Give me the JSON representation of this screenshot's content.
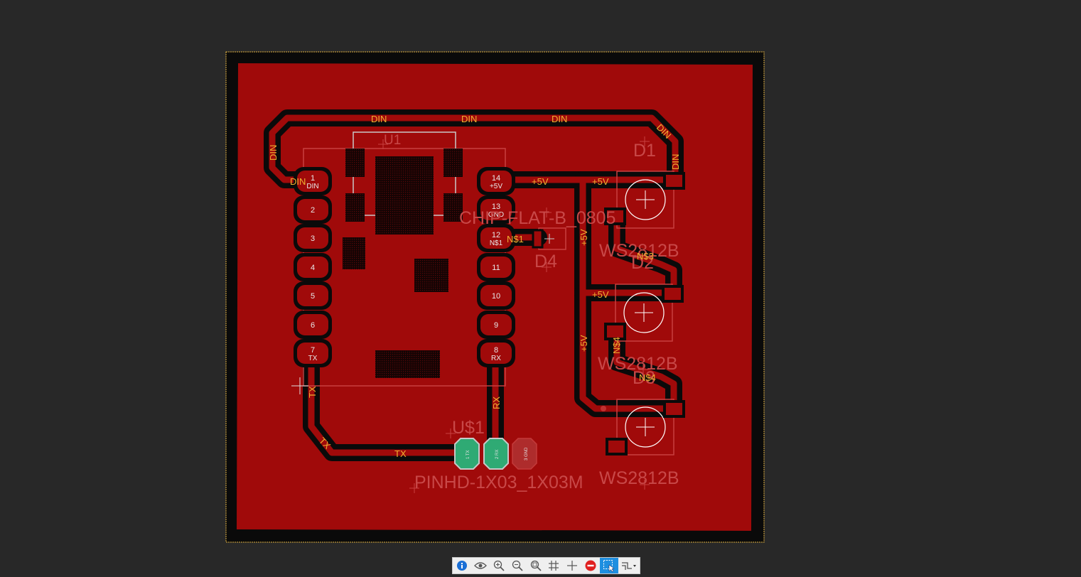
{
  "board": {
    "components": {
      "u1_name": "U1",
      "u1_package": "CHIP-FLAT-B_0805",
      "d1_name": "D1",
      "d2_name": "D2",
      "d3_name": "D3",
      "d4_name": "D4",
      "led_value_1": "WS2812B",
      "led_value_2": "WS2812B",
      "led_value_3": "WS2812B",
      "header_name": "U$1",
      "header_package": "PINHD-1X03_1X03M"
    },
    "left_pins": [
      {
        "num": "1",
        "label": "DIN"
      },
      {
        "num": "2",
        "label": ""
      },
      {
        "num": "3",
        "label": ""
      },
      {
        "num": "4",
        "label": ""
      },
      {
        "num": "5",
        "label": ""
      },
      {
        "num": "6",
        "label": ""
      },
      {
        "num": "7",
        "label": "TX"
      }
    ],
    "right_pins": [
      {
        "num": "14",
        "label": "+5V"
      },
      {
        "num": "13",
        "label": "GND"
      },
      {
        "num": "12",
        "label": "N$1"
      },
      {
        "num": "11",
        "label": ""
      },
      {
        "num": "10",
        "label": ""
      },
      {
        "num": "9",
        "label": ""
      },
      {
        "num": "8",
        "label": "RX"
      }
    ],
    "header_pins": [
      "1 TX",
      "2 RX",
      "3 GND"
    ],
    "nets": {
      "din": "DIN",
      "vcc": "+5V",
      "tx": "TX",
      "rx": "RX",
      "n1": "N$1",
      "n3": "N$3",
      "n4": "N$4"
    }
  },
  "toolbar": {
    "items": [
      {
        "name": "info-icon"
      },
      {
        "name": "eye-icon"
      },
      {
        "name": "zoom-in-icon"
      },
      {
        "name": "zoom-out-icon"
      },
      {
        "name": "zoom-fit-icon"
      },
      {
        "name": "grid-icon"
      },
      {
        "name": "crosshair-icon"
      },
      {
        "name": "stop-icon"
      },
      {
        "name": "select-icon",
        "active": true
      },
      {
        "name": "route-dropdown-icon"
      }
    ],
    "colors": {
      "accent": "#1f8fe0",
      "stop": "#e02020",
      "info": "#1a6fd6"
    }
  },
  "colors": {
    "background": "#282828",
    "board_fill": "#a00a0a",
    "board_edge": "#e0b040",
    "text_amber": "#f0b030",
    "silkscreen": "#ffffff",
    "pad_green": "#2faa74"
  }
}
